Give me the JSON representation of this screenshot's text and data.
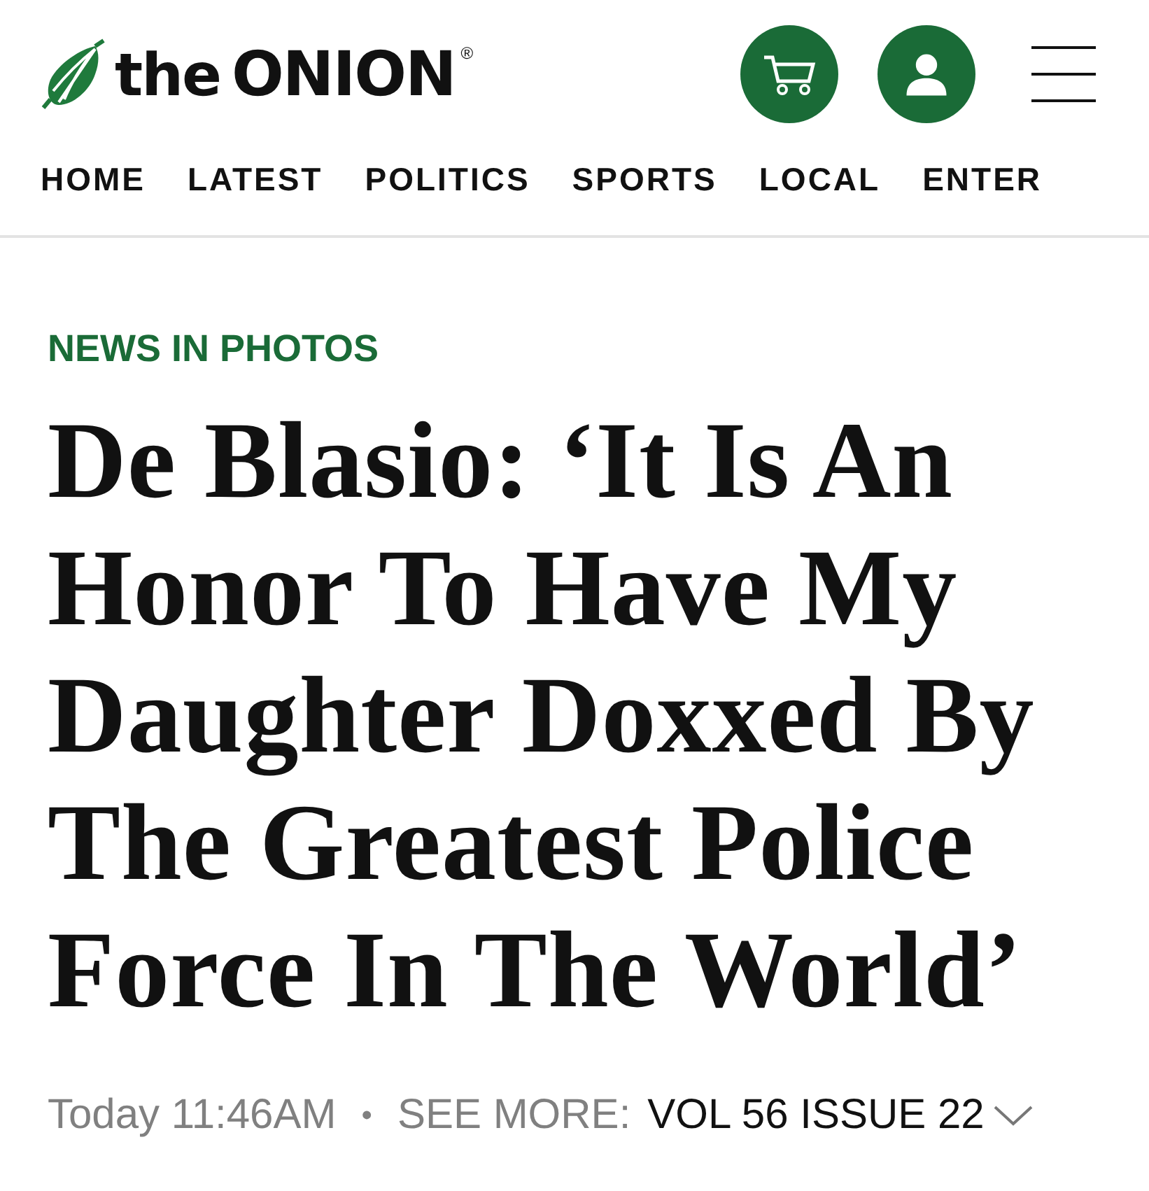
{
  "logo": {
    "word_small": "the",
    "word_big": "ONION",
    "mark": "®"
  },
  "nav": [
    {
      "label": "HOME"
    },
    {
      "label": "LATEST"
    },
    {
      "label": "POLITICS"
    },
    {
      "label": "SPORTS"
    },
    {
      "label": "LOCAL"
    },
    {
      "label": "ENTER"
    }
  ],
  "article": {
    "category": "NEWS IN PHOTOS",
    "headline_lines": [
      "De Blasio: ‘It Is An",
      "Honor To Have My",
      "Daughter Doxxed By",
      "The Greatest Police",
      "Force In The World’"
    ],
    "timestamp": "Today 11:46AM",
    "separator": "•",
    "see_more_label": "SEE MORE:",
    "issue_link": "VOL 56 ISSUE 22"
  }
}
